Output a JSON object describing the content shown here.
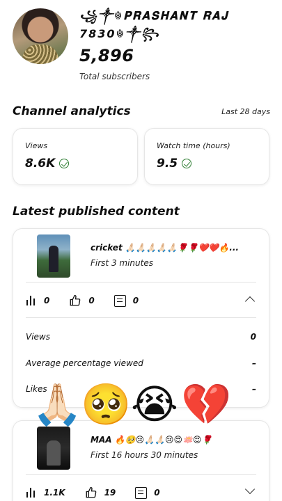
{
  "channel": {
    "name": "꧁༒☬𝐏𝐑𝐀𝐒𝐇𝐀𝐍𝐓 𝐑𝐀𝐉 7830☬༒꧂",
    "subscriber_count": "5,896",
    "subscriber_label": "Total subscribers"
  },
  "analytics": {
    "title": "Channel analytics",
    "period": "Last 28 days",
    "views_label": "Views",
    "views_value": "8.6K",
    "watch_label": "Watch time (hours)",
    "watch_value": "9.5"
  },
  "latest": {
    "title": "Latest published content",
    "videos": [
      {
        "title": "cricket 🙏🏻🙏🏻🙏🏻🙏🏻🙏🏻🌹🌹❤️❤️🔥...",
        "subtitle": "First 3 minutes",
        "views": "0",
        "likes": "0",
        "comments": "0",
        "details": [
          {
            "label": "Views",
            "value": "0"
          },
          {
            "label": "Average percentage viewed",
            "value": "–"
          },
          {
            "label": "Likes",
            "value": "–"
          }
        ]
      },
      {
        "title": "MAA 🔥🥺😢🙏🏻🙏🏻😢😍🪷😍🌹",
        "subtitle": "First 16 hours 30 minutes",
        "views": "1.1K",
        "likes": "19",
        "comments": "0"
      }
    ]
  },
  "overlay_emojis": [
    "🙏🏻",
    "🥺",
    "😭",
    "💔"
  ]
}
